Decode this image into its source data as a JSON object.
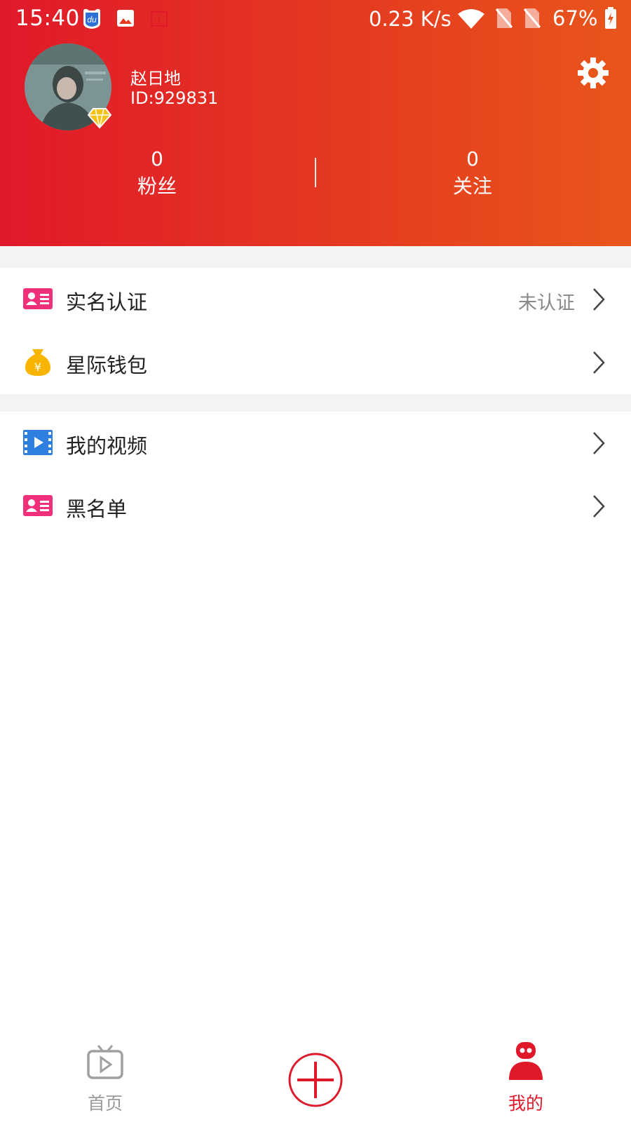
{
  "status_bar": {
    "time": "15:40",
    "network_speed": "0.23 K/s",
    "battery_percent": "67%"
  },
  "profile": {
    "username": "赵日地",
    "user_id": "ID:929831",
    "stats": [
      {
        "count": "0",
        "label": "粉丝"
      },
      {
        "count": "0",
        "label": "关注"
      }
    ]
  },
  "menu": {
    "group1": [
      {
        "label": "实名认证",
        "status": "未认证",
        "icon": "id-card-icon"
      },
      {
        "label": "星际钱包",
        "icon": "money-bag-icon"
      }
    ],
    "group2": [
      {
        "label": "我的视频",
        "icon": "video-icon"
      },
      {
        "label": "黑名单",
        "icon": "id-card-icon"
      }
    ]
  },
  "bottom_nav": {
    "tabs": [
      {
        "label": "首页",
        "icon": "tv-play-icon",
        "active": false
      },
      {
        "label": "我的",
        "icon": "robot-icon",
        "active": true
      }
    ]
  },
  "colors": {
    "header_start": "#e0192a",
    "header_end": "#e8561c",
    "accent": "#e0192a",
    "pink_icon": "#f0307a",
    "wallet_icon": "#f7b500",
    "video_icon": "#2f7fe0"
  }
}
